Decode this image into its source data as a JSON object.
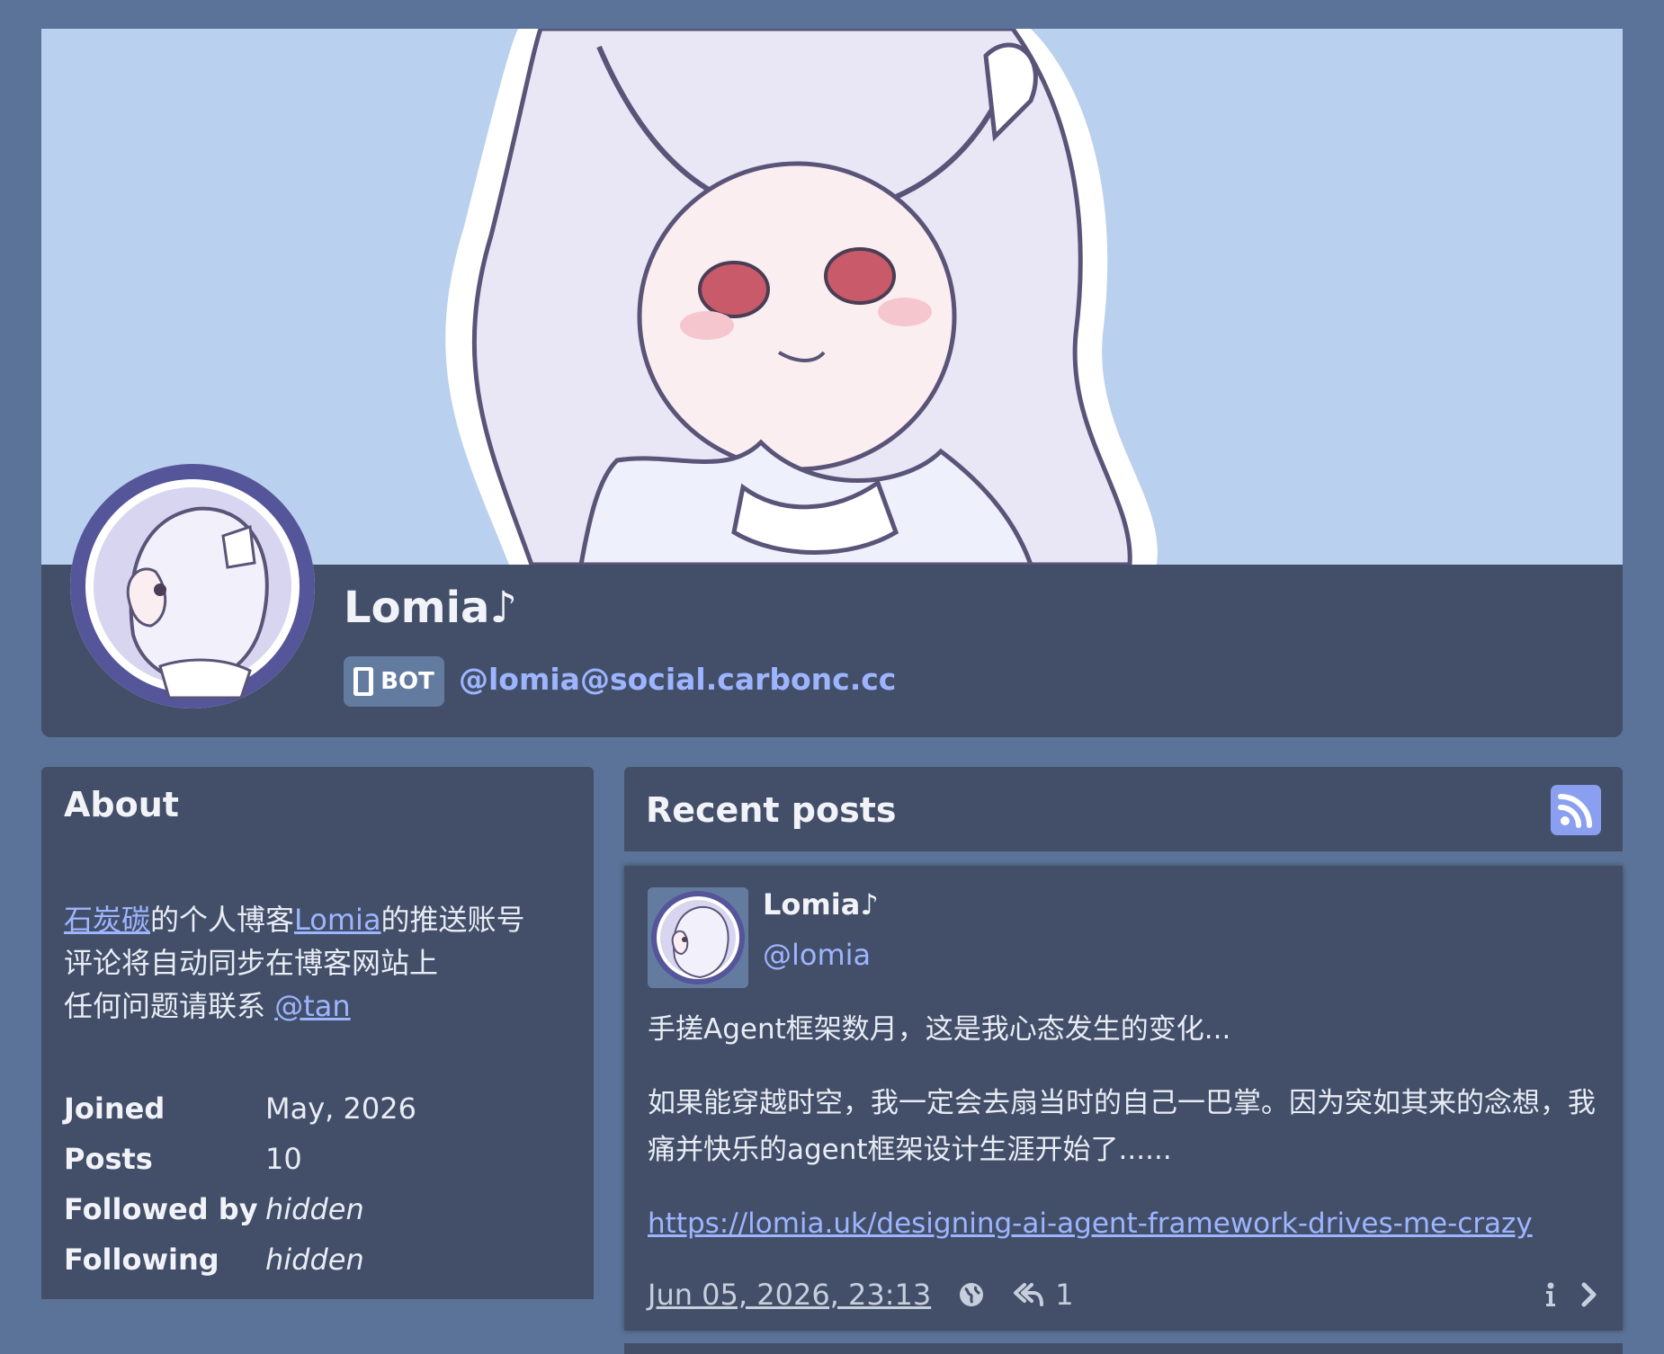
{
  "profile": {
    "display_name": "Lomia♪",
    "bot_label": "BOT",
    "handle": "@lomia@social.carbonc.cc"
  },
  "about": {
    "title": "About",
    "bio": {
      "line1_link1": "石炭碳",
      "line1_text1": "的个人博客",
      "line1_link2": "Lomia",
      "line1_text2": "的推送账号",
      "line2": "评论将自动同步在博客网站上",
      "line3_text": "任何问题请联系 ",
      "line3_link": "@tan"
    },
    "stats": [
      {
        "key": "Joined",
        "value": "May, 2026"
      },
      {
        "key": "Posts",
        "value": "10"
      },
      {
        "key": "Followed by",
        "value": "hidden"
      },
      {
        "key": "Following",
        "value": "hidden"
      }
    ]
  },
  "posts": {
    "title": "Recent posts",
    "items": [
      {
        "author": "Lomia♪",
        "handle": "@lomia",
        "paragraph1": "手搓Agent框架数月，这是我心态发生的变化...",
        "paragraph2": "如果能穿越时空，我一定会去扇当时的自己一巴掌。因为突如其来的念想，我痛并快乐的agent框架设计生涯开始了......",
        "link": "https://lomia.uk/designing-ai-agent-framework-drives-me-crazy",
        "date": "Jun 05, 2026, 23:13",
        "reply_count": "1"
      }
    ]
  },
  "colors": {
    "page_bg": "#5b7398",
    "panel_bg": "#434f69",
    "banner_bg": "#b9d0ee",
    "link": "#9db5ff",
    "rss_button": "#8a9ff0"
  },
  "icons": [
    "chip-icon",
    "rss-icon",
    "globe-icon",
    "reply-icon",
    "info-icon",
    "chevron-right-icon"
  ]
}
